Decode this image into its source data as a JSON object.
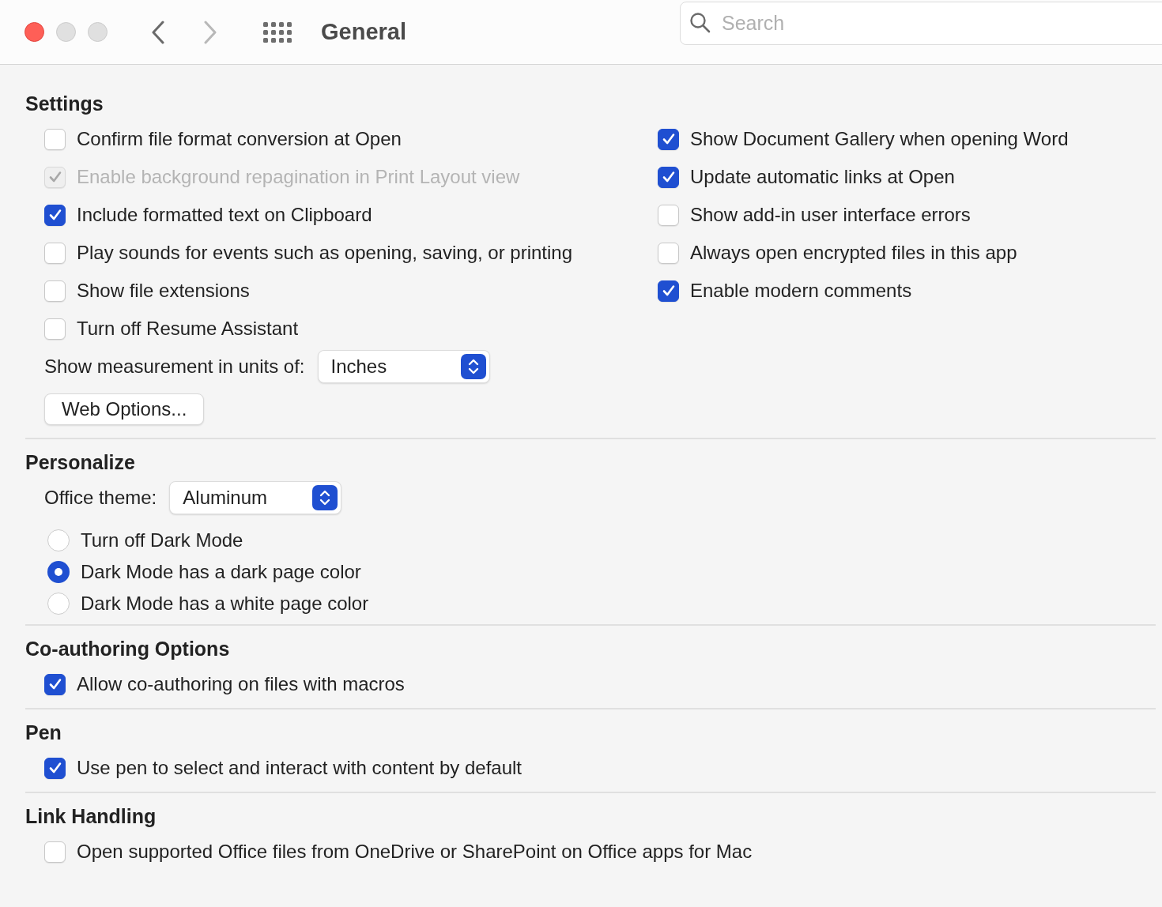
{
  "window": {
    "title": "General"
  },
  "nav": [
    {
      "kind": "back",
      "disabled": false
    },
    {
      "kind": "forward",
      "disabled": true
    }
  ],
  "search": {
    "placeholder": "Search"
  },
  "sections": [
    {
      "title": "Settings",
      "columns": [
        [
          {
            "kind": "checkbox",
            "label": "Confirm file format conversion at Open",
            "checked": false,
            "disabled": false
          },
          {
            "kind": "checkbox",
            "label": "Enable background repagination in Print Layout view",
            "checked": true,
            "disabled": true
          },
          {
            "kind": "checkbox",
            "label": "Include formatted text on Clipboard",
            "checked": true,
            "disabled": false
          },
          {
            "kind": "checkbox",
            "label": "Play sounds for events such as opening, saving, or printing",
            "checked": false,
            "disabled": false
          },
          {
            "kind": "checkbox",
            "label": "Show file extensions",
            "checked": false,
            "disabled": false
          },
          {
            "kind": "checkbox",
            "label": "Turn off Resume Assistant",
            "checked": false,
            "disabled": false
          },
          {
            "kind": "select",
            "label": "Show measurement in units of:",
            "value": "Inches"
          },
          {
            "kind": "button",
            "label": "Web Options..."
          }
        ],
        [
          {
            "kind": "checkbox",
            "label": "Show Document Gallery when opening Word",
            "checked": true,
            "disabled": false
          },
          {
            "kind": "checkbox",
            "label": "Update automatic links at Open",
            "checked": true,
            "disabled": false
          },
          {
            "kind": "checkbox",
            "label": "Show add-in user interface errors",
            "checked": false,
            "disabled": false
          },
          {
            "kind": "checkbox",
            "label": "Always open encrypted files in this app",
            "checked": false,
            "disabled": false
          },
          {
            "kind": "checkbox",
            "label": "Enable modern comments",
            "checked": true,
            "disabled": false
          }
        ]
      ]
    },
    {
      "title": "Personalize",
      "columns": [
        [
          {
            "kind": "select",
            "label": "Office theme:",
            "value": "Aluminum"
          },
          {
            "kind": "radio",
            "label": "Turn off Dark Mode",
            "selected": false
          },
          {
            "kind": "radio",
            "label": "Dark Mode has a dark page color",
            "selected": true
          },
          {
            "kind": "radio",
            "label": "Dark Mode has a white page color",
            "selected": false
          }
        ]
      ]
    },
    {
      "title": "Co-authoring Options",
      "columns": [
        [
          {
            "kind": "checkbox",
            "label": "Allow co-authoring on files with macros",
            "checked": true,
            "disabled": false
          }
        ]
      ]
    },
    {
      "title": "Pen",
      "columns": [
        [
          {
            "kind": "checkbox",
            "label": "Use pen to select and interact with content by default",
            "checked": true,
            "disabled": false
          }
        ]
      ]
    },
    {
      "title": "Link Handling",
      "columns": [
        [
          {
            "kind": "checkbox",
            "label": "Open supported Office files from OneDrive or SharePoint on Office apps for Mac",
            "checked": false,
            "disabled": false
          }
        ]
      ]
    }
  ]
}
